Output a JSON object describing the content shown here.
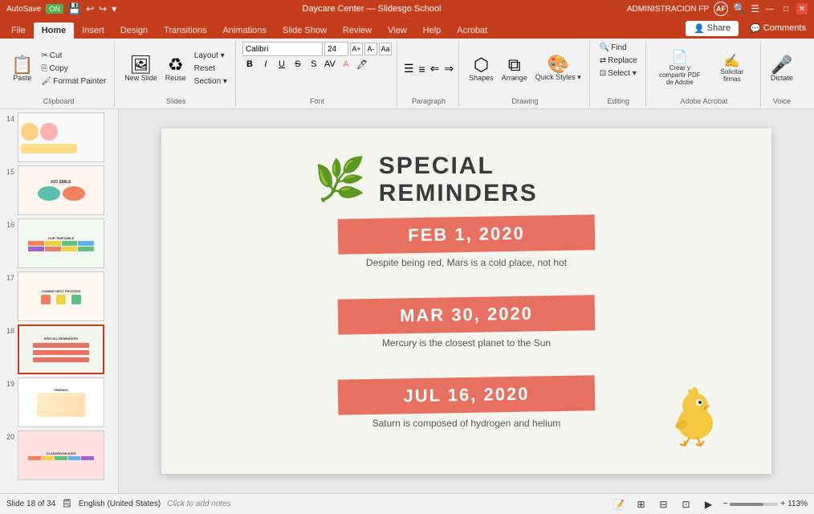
{
  "titleBar": {
    "autosave": "AutoSave",
    "autosave_on": "ON",
    "title": "Daycare Center — Slidesgo School",
    "user": "ADMINISTRACION FP",
    "user_initials": "AF",
    "min": "—",
    "max": "□",
    "close": "✕"
  },
  "ribbonTabs": {
    "tabs": [
      "File",
      "Home",
      "Insert",
      "Design",
      "Transitions",
      "Animations",
      "Slide Show",
      "Review",
      "View",
      "Help",
      "Acrobat"
    ],
    "active": "Home",
    "share": "Share",
    "comments": "Comments"
  },
  "ribbon": {
    "groups": {
      "clipboard": {
        "label": "Clipboard",
        "paste": "Paste",
        "cut": "Cut",
        "copy": "Copy",
        "format_painter": "Format Painter"
      },
      "slides": {
        "label": "Slides",
        "new_slide": "New Slide",
        "reuse": "Reuse",
        "layout": "Layout ▾",
        "reset": "Reset",
        "section": "Section ▾"
      },
      "font": {
        "label": "Font",
        "font_name": "Calibri",
        "font_size": "24",
        "bold": "B",
        "italic": "I",
        "underline": "U",
        "strikethrough": "S",
        "find": "Find",
        "replace": "Replace",
        "select": "Select ▾"
      },
      "paragraph": {
        "label": "Paragraph"
      },
      "drawing": {
        "label": "Drawing",
        "shapes": "Shapes",
        "arrange": "Arrange",
        "quick_styles": "Quick Styles ▾"
      },
      "editing": {
        "label": "Editing"
      },
      "adobe": {
        "label": "Adobe Acrobat",
        "create_pdf": "Crear y compartir PDF de Adobe",
        "solicitar": "Solicitar firmas"
      },
      "voice": {
        "label": "Voice",
        "dictate": "Dictate"
      }
    }
  },
  "slidePanel": {
    "slides": [
      {
        "num": "14",
        "active": false
      },
      {
        "num": "15",
        "active": false
      },
      {
        "num": "16",
        "active": false
      },
      {
        "num": "17",
        "active": false
      },
      {
        "num": "18",
        "active": true
      },
      {
        "num": "19",
        "active": false
      },
      {
        "num": "20",
        "active": false
      }
    ]
  },
  "mainSlide": {
    "title": "SPECIAL REMINDERS",
    "reminders": [
      {
        "date": "FEB 1, 2020",
        "description": "Despite being red, Mars is a cold place, not hot"
      },
      {
        "date": "MAR 30, 2020",
        "description": "Mercury is the closest planet to the Sun"
      },
      {
        "date": "JUL 16, 2020",
        "description": "Saturn is composed of hydrogen and helium"
      }
    ]
  },
  "bottomBar": {
    "slide_info": "Slide 18 of 34",
    "language": "English (United States)",
    "notes": "Notes",
    "click_to_add": "Click to add notes",
    "zoom": "113%"
  }
}
